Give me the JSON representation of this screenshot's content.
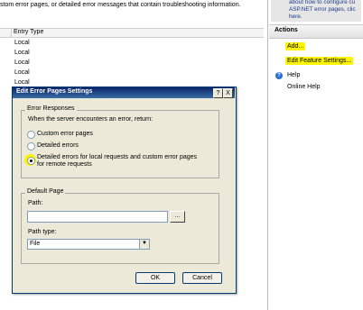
{
  "left_pane": {
    "description": "stom error pages, or detailed error messages that contain troubleshooting information.",
    "column_header": "Entry Type",
    "rows": [
      "Local",
      "Local",
      "Local",
      "Local",
      "Local"
    ]
  },
  "right_pane": {
    "top_text": "about how to configure cu ASP.NET error pages, clic here.",
    "actions_title": "Actions",
    "add_label": "Add...",
    "edit_feature_settings_label": "Edit Feature Settings...",
    "help_label": "Help",
    "online_help_label": "Online Help",
    "highlight_color": "#fcf400"
  },
  "dialog": {
    "title": "Edit Error Pages Settings",
    "help_btn": "?",
    "close_btn": "X",
    "error_responses": {
      "group_label": "Error Responses",
      "prompt": "When the server encounters an error, return:",
      "options": [
        {
          "label": "Custom error pages",
          "selected": false
        },
        {
          "label": "Detailed errors",
          "selected": false
        },
        {
          "label": "Detailed errors for local requests and custom error pages",
          "label2": "for remote requests",
          "selected": true
        }
      ]
    },
    "default_page": {
      "group_label": "Default Page",
      "path_label": "Path:",
      "path_value": "",
      "browse_label": "...",
      "path_type_label": "Path type:",
      "path_type_value": "File"
    },
    "ok_label": "OK",
    "cancel_label": "Cancel"
  }
}
